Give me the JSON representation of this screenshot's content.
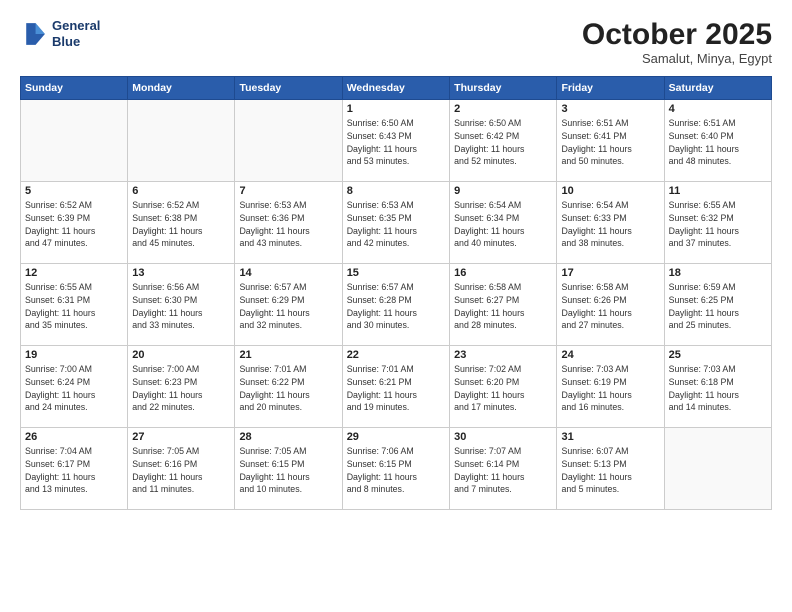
{
  "logo": {
    "line1": "General",
    "line2": "Blue"
  },
  "header": {
    "month": "October 2025",
    "location": "Samalut, Minya, Egypt"
  },
  "weekdays": [
    "Sunday",
    "Monday",
    "Tuesday",
    "Wednesday",
    "Thursday",
    "Friday",
    "Saturday"
  ],
  "weeks": [
    [
      {
        "day": "",
        "info": ""
      },
      {
        "day": "",
        "info": ""
      },
      {
        "day": "",
        "info": ""
      },
      {
        "day": "1",
        "info": "Sunrise: 6:50 AM\nSunset: 6:43 PM\nDaylight: 11 hours\nand 53 minutes."
      },
      {
        "day": "2",
        "info": "Sunrise: 6:50 AM\nSunset: 6:42 PM\nDaylight: 11 hours\nand 52 minutes."
      },
      {
        "day": "3",
        "info": "Sunrise: 6:51 AM\nSunset: 6:41 PM\nDaylight: 11 hours\nand 50 minutes."
      },
      {
        "day": "4",
        "info": "Sunrise: 6:51 AM\nSunset: 6:40 PM\nDaylight: 11 hours\nand 48 minutes."
      }
    ],
    [
      {
        "day": "5",
        "info": "Sunrise: 6:52 AM\nSunset: 6:39 PM\nDaylight: 11 hours\nand 47 minutes."
      },
      {
        "day": "6",
        "info": "Sunrise: 6:52 AM\nSunset: 6:38 PM\nDaylight: 11 hours\nand 45 minutes."
      },
      {
        "day": "7",
        "info": "Sunrise: 6:53 AM\nSunset: 6:36 PM\nDaylight: 11 hours\nand 43 minutes."
      },
      {
        "day": "8",
        "info": "Sunrise: 6:53 AM\nSunset: 6:35 PM\nDaylight: 11 hours\nand 42 minutes."
      },
      {
        "day": "9",
        "info": "Sunrise: 6:54 AM\nSunset: 6:34 PM\nDaylight: 11 hours\nand 40 minutes."
      },
      {
        "day": "10",
        "info": "Sunrise: 6:54 AM\nSunset: 6:33 PM\nDaylight: 11 hours\nand 38 minutes."
      },
      {
        "day": "11",
        "info": "Sunrise: 6:55 AM\nSunset: 6:32 PM\nDaylight: 11 hours\nand 37 minutes."
      }
    ],
    [
      {
        "day": "12",
        "info": "Sunrise: 6:55 AM\nSunset: 6:31 PM\nDaylight: 11 hours\nand 35 minutes."
      },
      {
        "day": "13",
        "info": "Sunrise: 6:56 AM\nSunset: 6:30 PM\nDaylight: 11 hours\nand 33 minutes."
      },
      {
        "day": "14",
        "info": "Sunrise: 6:57 AM\nSunset: 6:29 PM\nDaylight: 11 hours\nand 32 minutes."
      },
      {
        "day": "15",
        "info": "Sunrise: 6:57 AM\nSunset: 6:28 PM\nDaylight: 11 hours\nand 30 minutes."
      },
      {
        "day": "16",
        "info": "Sunrise: 6:58 AM\nSunset: 6:27 PM\nDaylight: 11 hours\nand 28 minutes."
      },
      {
        "day": "17",
        "info": "Sunrise: 6:58 AM\nSunset: 6:26 PM\nDaylight: 11 hours\nand 27 minutes."
      },
      {
        "day": "18",
        "info": "Sunrise: 6:59 AM\nSunset: 6:25 PM\nDaylight: 11 hours\nand 25 minutes."
      }
    ],
    [
      {
        "day": "19",
        "info": "Sunrise: 7:00 AM\nSunset: 6:24 PM\nDaylight: 11 hours\nand 24 minutes."
      },
      {
        "day": "20",
        "info": "Sunrise: 7:00 AM\nSunset: 6:23 PM\nDaylight: 11 hours\nand 22 minutes."
      },
      {
        "day": "21",
        "info": "Sunrise: 7:01 AM\nSunset: 6:22 PM\nDaylight: 11 hours\nand 20 minutes."
      },
      {
        "day": "22",
        "info": "Sunrise: 7:01 AM\nSunset: 6:21 PM\nDaylight: 11 hours\nand 19 minutes."
      },
      {
        "day": "23",
        "info": "Sunrise: 7:02 AM\nSunset: 6:20 PM\nDaylight: 11 hours\nand 17 minutes."
      },
      {
        "day": "24",
        "info": "Sunrise: 7:03 AM\nSunset: 6:19 PM\nDaylight: 11 hours\nand 16 minutes."
      },
      {
        "day": "25",
        "info": "Sunrise: 7:03 AM\nSunset: 6:18 PM\nDaylight: 11 hours\nand 14 minutes."
      }
    ],
    [
      {
        "day": "26",
        "info": "Sunrise: 7:04 AM\nSunset: 6:17 PM\nDaylight: 11 hours\nand 13 minutes."
      },
      {
        "day": "27",
        "info": "Sunrise: 7:05 AM\nSunset: 6:16 PM\nDaylight: 11 hours\nand 11 minutes."
      },
      {
        "day": "28",
        "info": "Sunrise: 7:05 AM\nSunset: 6:15 PM\nDaylight: 11 hours\nand 10 minutes."
      },
      {
        "day": "29",
        "info": "Sunrise: 7:06 AM\nSunset: 6:15 PM\nDaylight: 11 hours\nand 8 minutes."
      },
      {
        "day": "30",
        "info": "Sunrise: 7:07 AM\nSunset: 6:14 PM\nDaylight: 11 hours\nand 7 minutes."
      },
      {
        "day": "31",
        "info": "Sunrise: 6:07 AM\nSunset: 5:13 PM\nDaylight: 11 hours\nand 5 minutes."
      },
      {
        "day": "",
        "info": ""
      }
    ]
  ]
}
